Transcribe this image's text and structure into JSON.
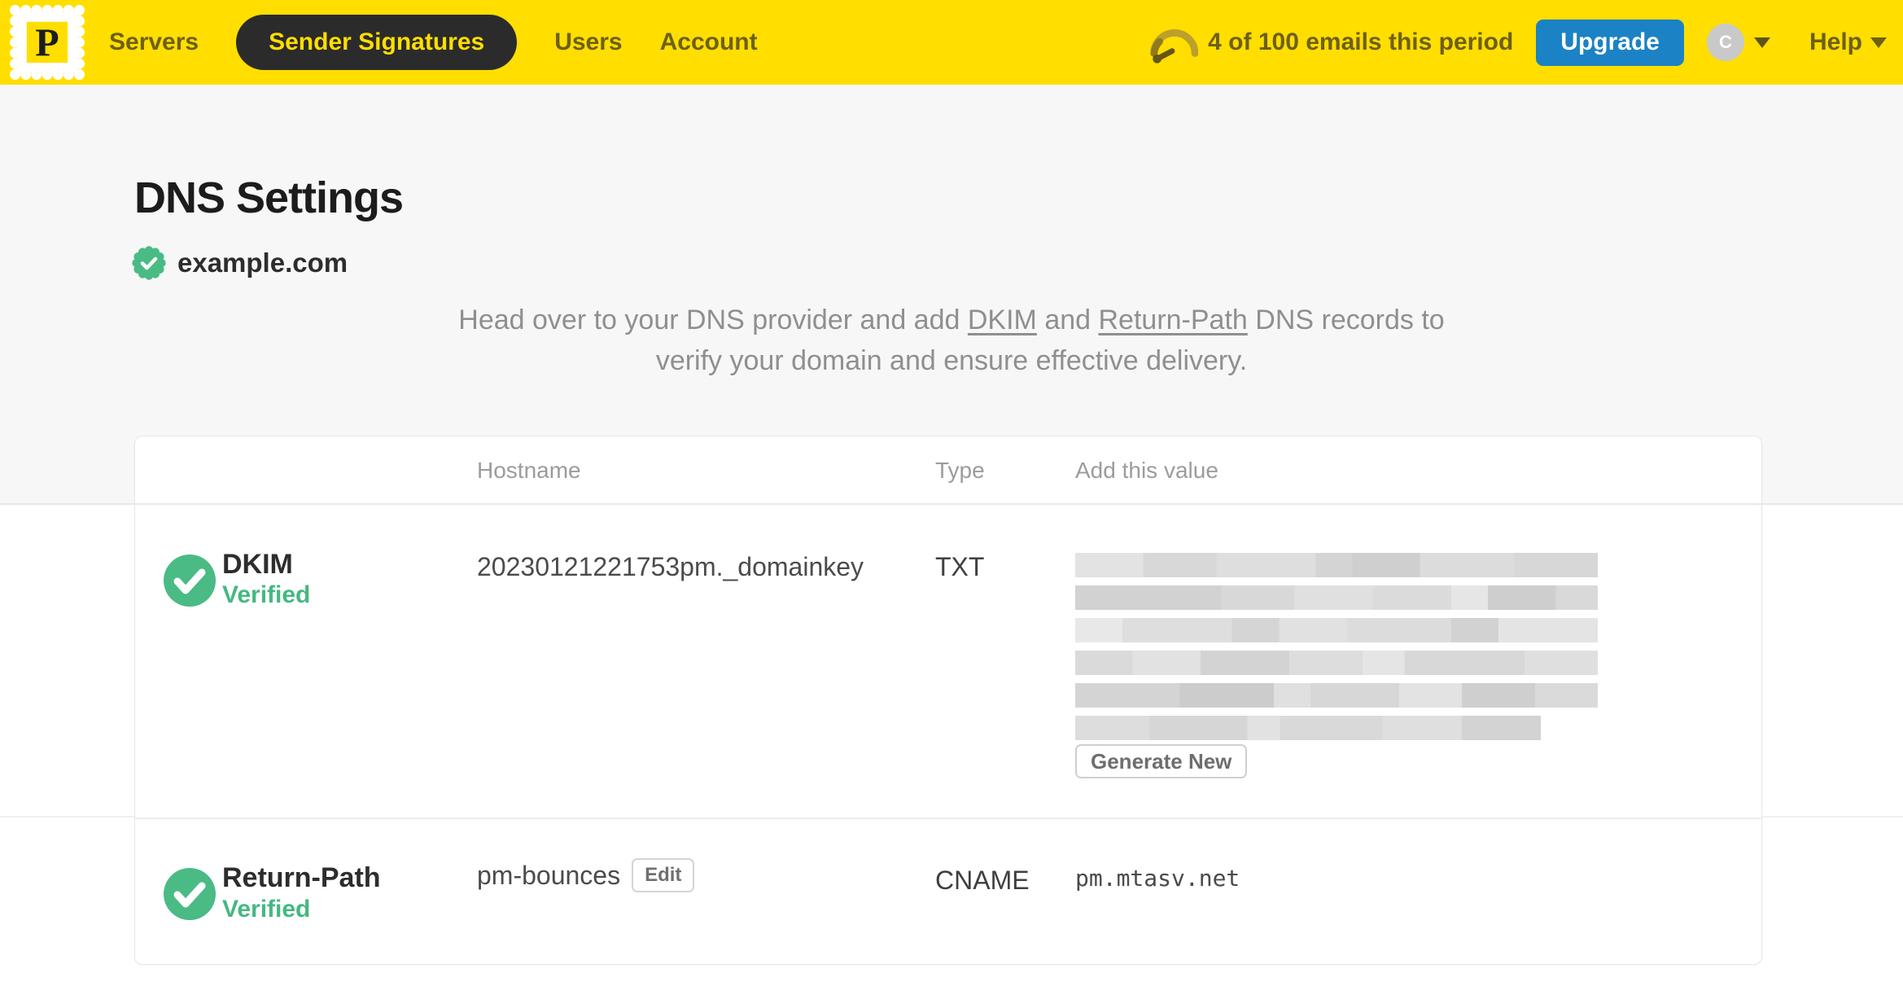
{
  "navbar": {
    "logo_letter": "P",
    "items": [
      {
        "label": "Servers",
        "active": false
      },
      {
        "label": "Sender Signatures",
        "active": true
      },
      {
        "label": "Users",
        "active": false
      },
      {
        "label": "Account",
        "active": false
      }
    ],
    "usage_text": "4 of 100 emails this period",
    "upgrade_label": "Upgrade",
    "avatar_initial": "C",
    "help_label": "Help"
  },
  "page": {
    "title": "DNS Settings",
    "domain": "example.com",
    "domain_verified": true,
    "instruction": {
      "line1_pre": "Head over to your DNS provider and add ",
      "link_dkim": "DKIM",
      "line1_mid": " and ",
      "link_return_path": "Return-Path",
      "line1_post": " DNS records to",
      "line2": "verify your domain and ensure effective delivery."
    }
  },
  "table": {
    "headers": {
      "hostname": "Hostname",
      "type": "Type",
      "value": "Add this value"
    },
    "rows": [
      {
        "name": "DKIM",
        "status": "Verified",
        "hostname": "20230121221753pm._domainkey",
        "type": "TXT",
        "value_redacted": true,
        "action_label": "Generate New"
      },
      {
        "name": "Return-Path",
        "status": "Verified",
        "hostname": "pm-bounces",
        "edit_label": "Edit",
        "type": "CNAME",
        "value": "pm.mtasv.net"
      }
    ]
  },
  "colors": {
    "brand_yellow": "#FFDE00",
    "nav_text": "#6D6015",
    "active_pill_bg": "#2B2B2B",
    "upgrade_blue": "#1B82C5",
    "verified_green": "#45B881",
    "muted_text": "#8F8F8F"
  }
}
